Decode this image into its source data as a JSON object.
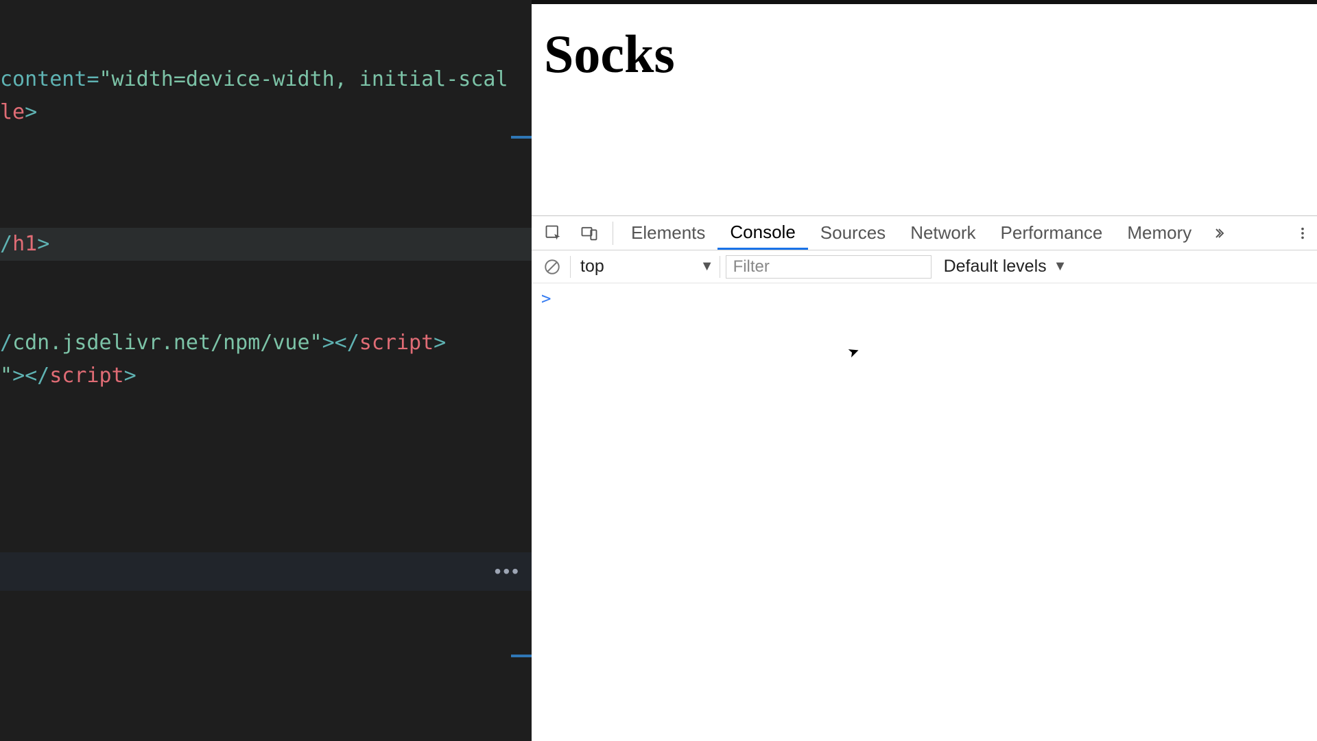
{
  "editor": {
    "lines": [
      {
        "segments": [
          {
            "cls": "tok-attr",
            "text": "content"
          },
          {
            "cls": "tok-punct",
            "text": "="
          },
          {
            "cls": "tok-string",
            "text": "\"width=device-width, initial-scal"
          }
        ]
      },
      {
        "segments": [
          {
            "cls": "tok-tag",
            "text": "le"
          },
          {
            "cls": "tok-punct",
            "text": ">"
          }
        ]
      },
      {
        "segments": []
      },
      {
        "segments": []
      },
      {
        "segments": []
      },
      {
        "hl": true,
        "segments": [
          {
            "cls": "tok-punct",
            "text": "/"
          },
          {
            "cls": "tok-tag",
            "text": "h1"
          },
          {
            "cls": "tok-punct",
            "text": ">"
          }
        ]
      },
      {
        "segments": []
      },
      {
        "segments": []
      },
      {
        "segments": [
          {
            "cls": "tok-punct",
            "text": "/"
          },
          {
            "cls": "tok-string",
            "text": "cdn.jsdelivr.net/npm/vue"
          },
          {
            "cls": "tok-string",
            "text": "\""
          },
          {
            "cls": "tok-punct",
            "text": "></"
          },
          {
            "cls": "tok-tag",
            "text": "script"
          },
          {
            "cls": "tok-punct",
            "text": ">"
          }
        ]
      },
      {
        "segments": [
          {
            "cls": "tok-string",
            "text": "\""
          },
          {
            "cls": "tok-punct",
            "text": "></"
          },
          {
            "cls": "tok-tag",
            "text": "script"
          },
          {
            "cls": "tok-punct",
            "text": ">"
          }
        ]
      }
    ],
    "ellipsis_label": "•••"
  },
  "page": {
    "heading": "Socks"
  },
  "devtools": {
    "tabs": [
      "Elements",
      "Console",
      "Sources",
      "Network",
      "Performance",
      "Memory"
    ],
    "active_tab_index": 1,
    "context_label": "top",
    "filter_placeholder": "Filter",
    "levels_label": "Default levels",
    "prompt_char": ">"
  }
}
